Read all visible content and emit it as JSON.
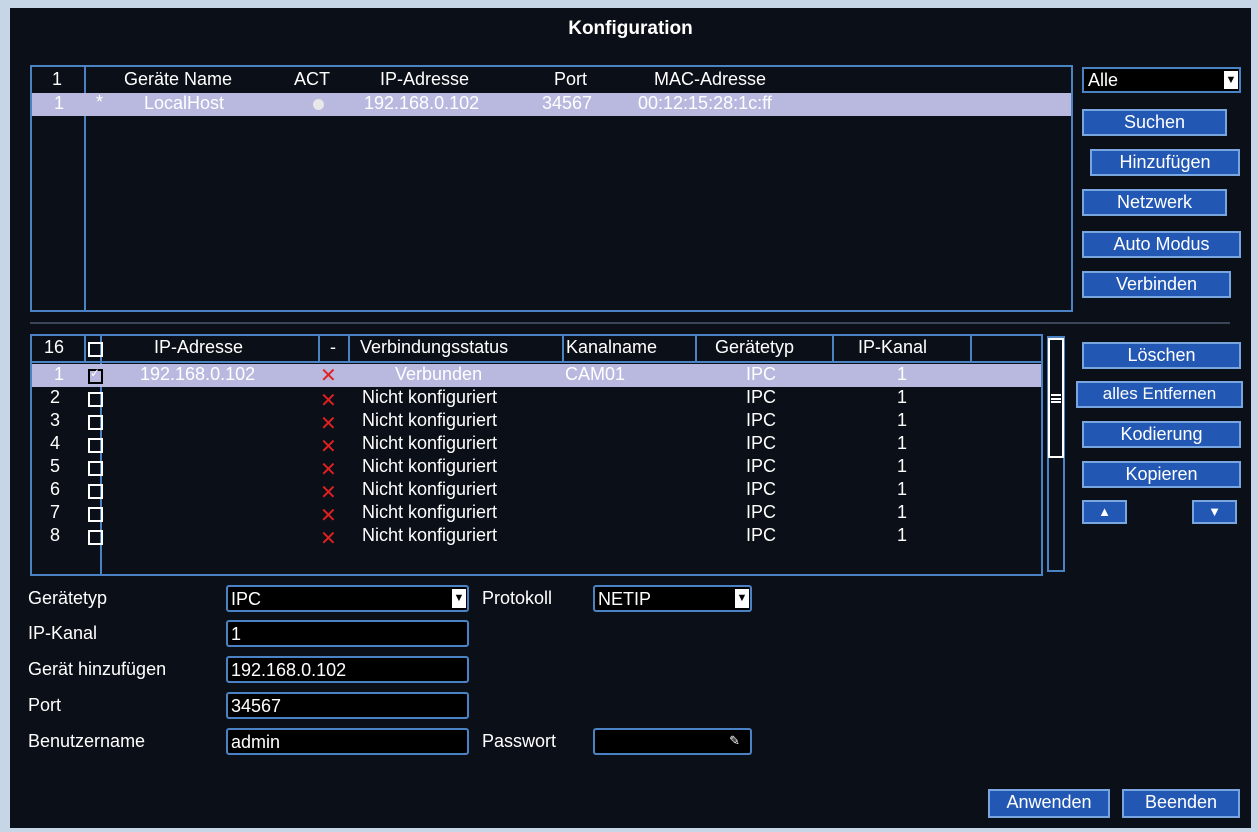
{
  "window": {
    "title": "Konfiguration"
  },
  "device_list": {
    "headers": {
      "index": "1",
      "name": "Geräte Name",
      "act": "ACT",
      "ip": "IP-Adresse",
      "port": "Port",
      "mac": "MAC-Adresse"
    },
    "rows": [
      {
        "index": "1",
        "marker": "*",
        "name": "LocalHost",
        "act": "status-dot-icon",
        "ip": "192.168.0.102",
        "port": "34567",
        "mac": "00:12:15:28:1c:ff"
      }
    ]
  },
  "filter": {
    "selected": "Alle"
  },
  "right_buttons": {
    "search": "Suchen",
    "add": "Hinzufügen",
    "network": "Netzwerk",
    "auto_mode": "Auto Modus",
    "connect": "Verbinden",
    "delete": "Löschen",
    "remove_all": "alles Entfernen",
    "encoding": "Kodierung",
    "copy": "Kopieren",
    "up": "▲",
    "down": "▼"
  },
  "channel_list": {
    "headers": {
      "index": "16",
      "ip": "IP-Adresse",
      "dash": "-",
      "status": "Verbindungsstatus",
      "channel_name": "Kanalname",
      "device_type": "Gerätetyp",
      "ip_channel": "IP-Kanal"
    },
    "rows": [
      {
        "index": "1",
        "checked": true,
        "ip": "192.168.0.102",
        "status": "Verbunden",
        "channel_name": "CAM01",
        "device_type": "IPC",
        "ip_channel": "1"
      },
      {
        "index": "2",
        "checked": false,
        "ip": "",
        "status": "Nicht konfiguriert",
        "channel_name": "",
        "device_type": "IPC",
        "ip_channel": "1"
      },
      {
        "index": "3",
        "checked": false,
        "ip": "",
        "status": "Nicht konfiguriert",
        "channel_name": "",
        "device_type": "IPC",
        "ip_channel": "1"
      },
      {
        "index": "4",
        "checked": false,
        "ip": "",
        "status": "Nicht konfiguriert",
        "channel_name": "",
        "device_type": "IPC",
        "ip_channel": "1"
      },
      {
        "index": "5",
        "checked": false,
        "ip": "",
        "status": "Nicht konfiguriert",
        "channel_name": "",
        "device_type": "IPC",
        "ip_channel": "1"
      },
      {
        "index": "6",
        "checked": false,
        "ip": "",
        "status": "Nicht konfiguriert",
        "channel_name": "",
        "device_type": "IPC",
        "ip_channel": "1"
      },
      {
        "index": "7",
        "checked": false,
        "ip": "",
        "status": "Nicht konfiguriert",
        "channel_name": "",
        "device_type": "IPC",
        "ip_channel": "1"
      },
      {
        "index": "8",
        "checked": false,
        "ip": "",
        "status": "Nicht konfiguriert",
        "channel_name": "",
        "device_type": "IPC",
        "ip_channel": "1"
      }
    ]
  },
  "form": {
    "device_type_label": "Gerätetyp",
    "device_type_value": "IPC",
    "protocol_label": "Protokoll",
    "protocol_value": "NETIP",
    "ip_channel_label": "IP-Kanal",
    "ip_channel_value": "1",
    "add_device_label": "Gerät hinzufügen",
    "add_device_value": "192.168.0.102",
    "port_label": "Port",
    "port_value": "34567",
    "username_label": "Benutzername",
    "username_value": "admin",
    "password_label": "Passwort",
    "password_value": ""
  },
  "footer": {
    "apply": "Anwenden",
    "exit": "Beenden"
  },
  "colors": {
    "background": "#0b0f17",
    "border": "#4a82c4",
    "button": "#2258b4",
    "selection": "#b9b9e0",
    "status_error": "#e12020"
  }
}
